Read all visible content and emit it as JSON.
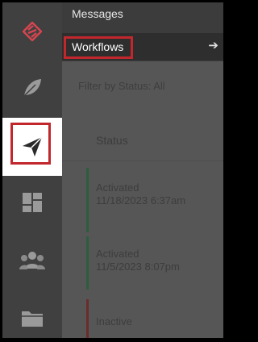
{
  "rail": {
    "items": [
      {
        "icon": "logo-icon"
      },
      {
        "icon": "leaf-icon"
      },
      {
        "icon": "paper-plane-icon",
        "active": true
      },
      {
        "icon": "dashboard-icon"
      },
      {
        "icon": "users-icon"
      },
      {
        "icon": "folder-icon"
      }
    ]
  },
  "flyout": {
    "messages_label": "Messages",
    "workflows_label": "Workflows",
    "workflows_arrow": "➔"
  },
  "main": {
    "filter_label": "Filter by Status: All",
    "status_header": "Status",
    "rows": [
      {
        "status": "Activated",
        "date": "11/18/2023 6:37am",
        "bar_color": "#2d5d3f"
      },
      {
        "status": "Activated",
        "date": "11/5/2023 8:07pm",
        "bar_color": "#2d5d3f"
      },
      {
        "status": "Inactive",
        "date": "",
        "bar_color": "#6a2d2d"
      }
    ]
  },
  "colors": {
    "accent_red": "#c1272d",
    "logo_red": "#d64550"
  }
}
